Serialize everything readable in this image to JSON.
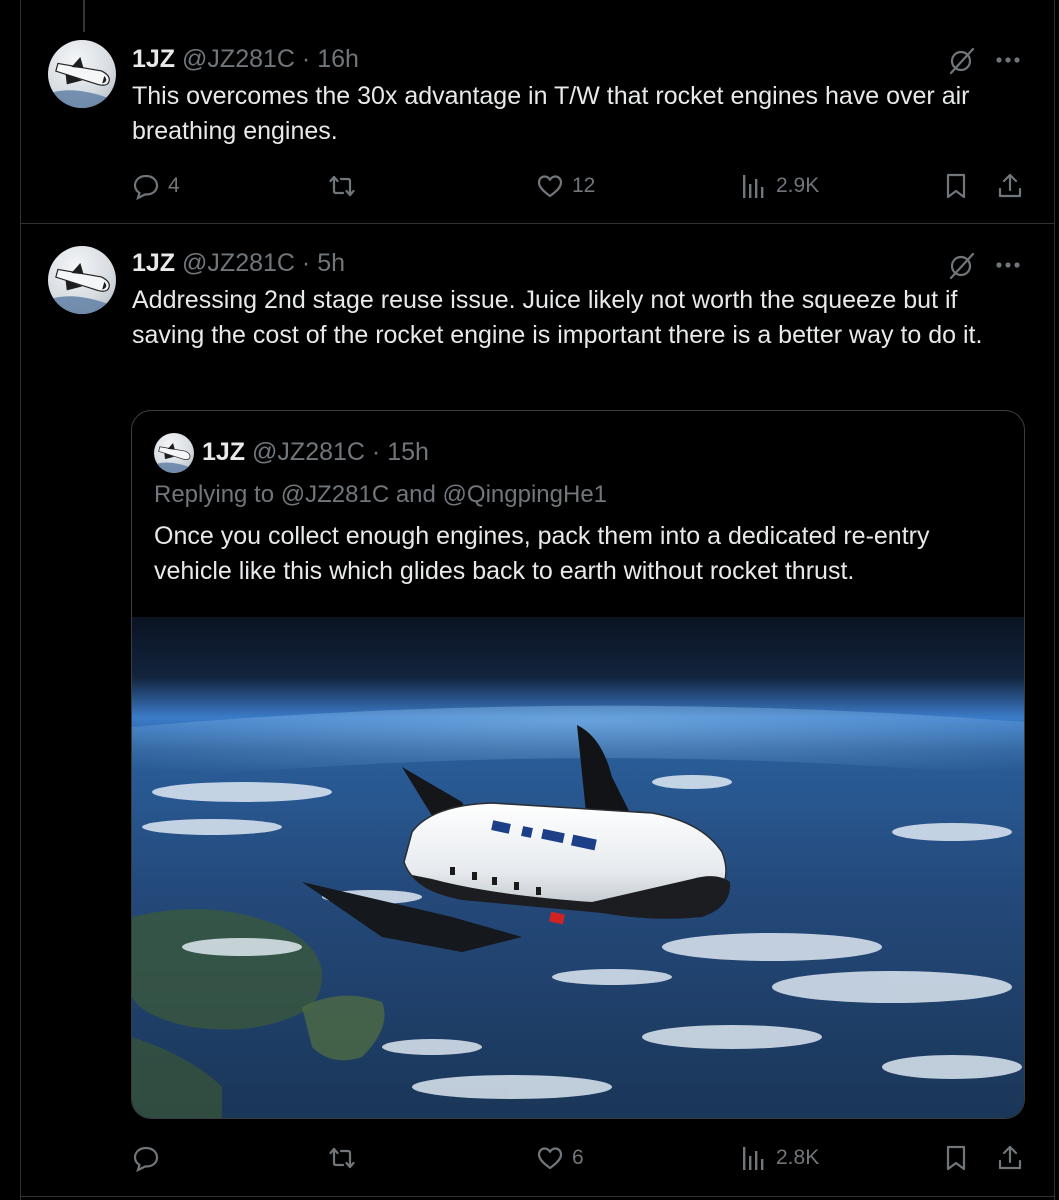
{
  "tweets": [
    {
      "display_name": "1JZ",
      "handle": "@JZ281C",
      "time": "16h",
      "text": "This overcomes the 30x advantage in T/W that rocket engines have over air breathing engines.",
      "replies": "4",
      "reposts": "",
      "likes": "12",
      "views": "2.9K"
    },
    {
      "display_name": "1JZ",
      "handle": "@JZ281C",
      "time": "5h",
      "text": "Addressing 2nd stage reuse issue. Juice likely not worth the squeeze but if saving the cost of the rocket engine is important there is a better way to do it.",
      "replies": "",
      "reposts": "",
      "likes": "6",
      "views": "2.8K",
      "quoted": {
        "display_name": "1JZ",
        "handle": "@JZ281C",
        "time": "15h",
        "replying_prefix": "Replying to",
        "replying_to_1": "@JZ281C",
        "replying_and": "and",
        "replying_to_2": "@QingpingHe1",
        "text": "Once you collect enough engines, pack them into a dedicated re-entry vehicle like this which glides back to earth without rocket thrust.",
        "media": "spaceplane-over-earth-image"
      }
    }
  ],
  "separator": "·",
  "icons": {
    "reply": "reply-icon",
    "repost": "repost-icon",
    "like": "like-icon",
    "views": "views-icon",
    "bookmark": "bookmark-icon",
    "share": "share-icon",
    "grok": "grok-icon",
    "more": "more-icon"
  },
  "colors": {
    "background": "#000000",
    "text": "#e7e9ea",
    "muted": "#71767b",
    "border": "#2f3336"
  }
}
